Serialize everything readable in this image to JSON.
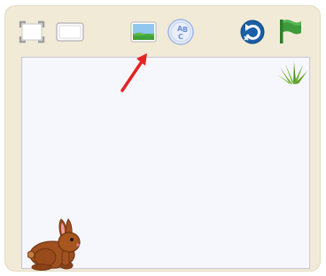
{
  "toolbar": {
    "icons": [
      {
        "name": "fullscreen-icon"
      },
      {
        "name": "small-stage-icon"
      },
      {
        "name": "background-image-icon"
      },
      {
        "name": "text-abc-icon",
        "letters": [
          "A",
          "B",
          "C"
        ]
      },
      {
        "name": "reset-icon"
      },
      {
        "name": "green-flag-icon"
      }
    ]
  },
  "stage": {
    "sprites": [
      {
        "name": "rabbit-sprite"
      },
      {
        "name": "grass-sprite"
      }
    ]
  },
  "colors": {
    "frame": "#f1ead7",
    "stage": "#f6f6fd",
    "flag": "#3f9a3c",
    "reset": "#1b5fa7",
    "arrow": "#e32424",
    "rabbit": "#a0511f"
  }
}
